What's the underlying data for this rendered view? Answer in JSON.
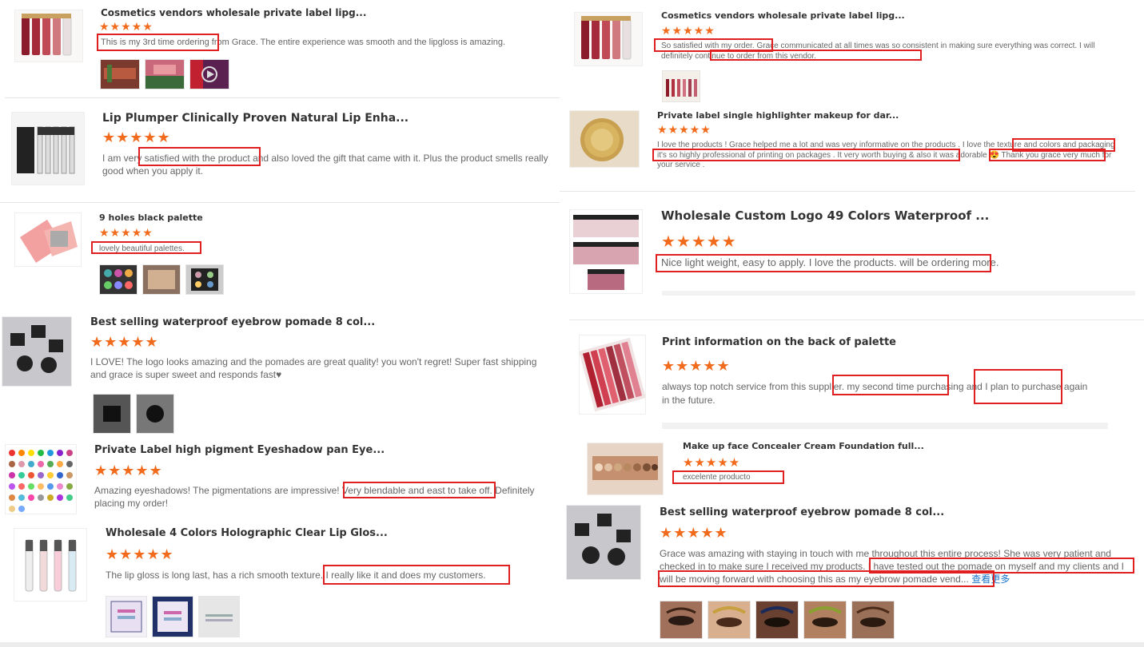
{
  "stars": "★★★★★",
  "colors": {
    "star": "#f26a1b",
    "highlight": "#e02020",
    "link": "#1a73c8"
  },
  "left": [
    {
      "title": "Cosmetics vendors wholesale private label lipg...",
      "text": "This is my 3rd time  ordering from Grace. The entire experience was smooth and the lipgloss is amazing."
    },
    {
      "title": "Lip Plumper Clinically Proven Natural Lip Enha...",
      "text": "I am very satisfied with the product and also loved the gift that came with it. Plus the product smells really good when you apply it."
    },
    {
      "title": "9 holes black palette",
      "text": "lovely beautiful palettes."
    },
    {
      "title": "Best selling waterproof eyebrow pomade 8 col...",
      "text": "I LOVE! The logo looks amazing and the pomades are great quality! you won't regret! Super fast shipping and grace is super sweet and responds fast♥"
    },
    {
      "title": "Private Label high pigment Eyeshadow pan Eye...",
      "text": "Amazing eyeshadows! The pigmentations are impressive! Very blendable and east to take off. Definitely placing my order!"
    },
    {
      "title": "Wholesale 4 Colors Holographic Clear Lip Glos...",
      "text": "The lip gloss is long last, has a rich smooth texture. I really like it and does my customers."
    }
  ],
  "right": [
    {
      "title": "Cosmetics vendors wholesale private label lipg...",
      "text": "So satisfied with my order. Grace communicated at all times was so consistent in making sure everything was correct. I will definitely continue to order from this vendor."
    },
    {
      "title": "Private label single highlighter makeup for dar...",
      "text": "I love the products ! Grace helped me a lot and was very informative on the products . I love the texture and colors and packaging it's so highly professional of printing on packages . It very worth buying & also it was adorable 😍 Thank you grace very much for your service ."
    },
    {
      "title": "Wholesale Custom Logo 49 Colors Waterproof ...",
      "text": "Nice light weight, easy to apply. I love the products. will be ordering more."
    },
    {
      "title": "Print information on the back of palette",
      "text": "always top notch service from this supplier. my second time purchasing and I plan to purchase again in the future."
    },
    {
      "title": "Make up face Concealer Cream Foundation full...",
      "text": "excelente producto"
    },
    {
      "title": "Best selling waterproof eyebrow pomade 8 col...",
      "text": "Grace was amazing with staying in touch with me throughout this entire process! She was very patient and checked in to make sure I received my products. I have tested out the pomade on myself and my clients and I will be moving forward with choosing this as my eyebrow pomade vend...",
      "more": "查看更多"
    }
  ]
}
